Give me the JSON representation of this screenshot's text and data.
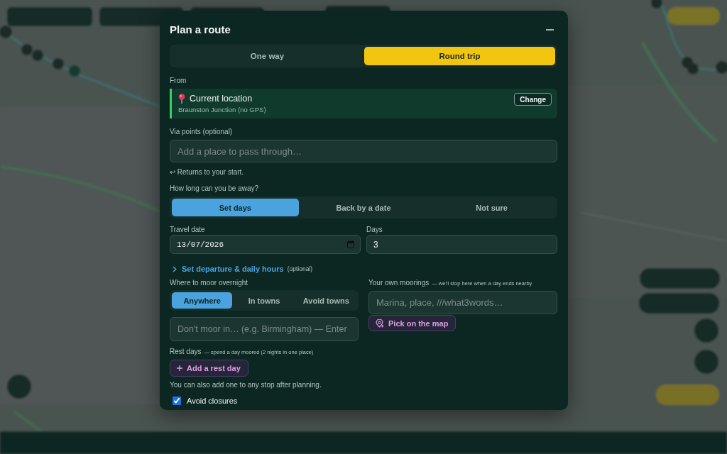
{
  "dialog": {
    "title": "Plan a route"
  },
  "trip_type": [
    {
      "label": "One way",
      "selected": false
    },
    {
      "label": "Round trip",
      "selected": true
    }
  ],
  "from": {
    "label": "From",
    "title": "Current location",
    "subtitle": "Braunston Junction (no GPS)",
    "button": "Change"
  },
  "via": {
    "label": "Via points (optional)",
    "placeholder": "Add a place to pass through…",
    "hint": "↩ Returns to your start."
  },
  "duration": {
    "label": "How long can you be away?",
    "options": [
      {
        "label": "Set days",
        "selected": true
      },
      {
        "label": "Back by a date",
        "selected": false
      },
      {
        "label": "Not sure",
        "selected": false
      }
    ]
  },
  "travel_date": {
    "label": "Travel date",
    "value": "13/07/2026"
  },
  "days": {
    "label": "Days",
    "value": "3"
  },
  "departure_link": {
    "label": "Set departure & daily hours",
    "note": "(optional)",
    "expanded": false
  },
  "mooring": {
    "label": "Where to moor overnight",
    "options": [
      {
        "label": "Anywhere",
        "selected": true
      },
      {
        "label": "In towns",
        "selected": false
      },
      {
        "label": "Avoid towns",
        "selected": false
      }
    ],
    "avoid_placeholder": "Don't moor in… (e.g. Birmingham) — Enter"
  },
  "own_moorings": {
    "label": "Your own moorings",
    "note": "— we'll stop here when a day ends nearby",
    "placeholder": "Marina, place, ///what3words…",
    "button": "Pick on the map"
  },
  "rest_days": {
    "label": "Rest days",
    "note": "— spend a day moored (2 nights in one place)",
    "button": "Add a rest day",
    "hint": "You can also add one to any stop after planning."
  },
  "options": [
    {
      "label": "Avoid closures",
      "checked": true
    }
  ]
}
